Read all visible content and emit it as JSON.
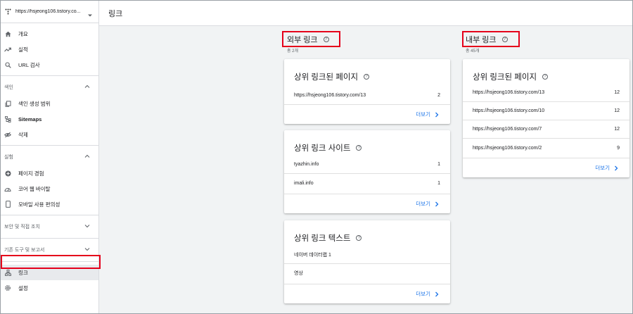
{
  "property": {
    "url": "https://hsjeong106.tistory.co..."
  },
  "sidebar": {
    "items": [
      {
        "label": "개요"
      },
      {
        "label": "실적"
      },
      {
        "label": "URL 검사"
      }
    ],
    "index_section": "색인",
    "index_items": [
      {
        "label": "색인 생성 범위"
      },
      {
        "label": "Sitemaps"
      },
      {
        "label": "삭제"
      }
    ],
    "experience_section": "실험",
    "experience_items": [
      {
        "label": "페이지 경험"
      },
      {
        "label": "코어 웹 바이탈"
      },
      {
        "label": "모바일 사용 편의성"
      }
    ],
    "security_section": "보안 및 직접 조치",
    "legacy_section": "기존 도구 및 보고서",
    "links_label": "링크",
    "settings_label": "설정"
  },
  "header": {
    "title": "링크"
  },
  "external": {
    "title": "외부 링크",
    "total": "총 2개",
    "top_linked_pages": {
      "title": "상위 링크된 페이지",
      "rows": [
        {
          "label": "https://hsjeong106.tistory.com/13",
          "value": "2"
        }
      ],
      "more": "더보기"
    },
    "top_linking_sites": {
      "title": "상위 링크 사이트",
      "rows": [
        {
          "label": "tyazhin.info",
          "value": "1"
        },
        {
          "label": "imali.info",
          "value": "1"
        }
      ],
      "more": "더보기"
    },
    "top_linking_text": {
      "title": "상위 링크 텍스트",
      "rows": [
        {
          "label": "네이버 데이터랩 1"
        },
        {
          "label": "영상"
        }
      ],
      "more": "더보기"
    }
  },
  "internal": {
    "title": "내부 링크",
    "total": "총 45개",
    "top_linked_pages": {
      "title": "상위 링크된 페이지",
      "rows": [
        {
          "label": "https://hsjeong106.tistory.com/13",
          "value": "12"
        },
        {
          "label": "https://hsjeong106.tistory.com/10",
          "value": "12"
        },
        {
          "label": "https://hsjeong106.tistory.com/7",
          "value": "12"
        },
        {
          "label": "https://hsjeong106.tistory.com/2",
          "value": "9"
        }
      ],
      "more": "더보기"
    }
  },
  "colors": {
    "highlight": "#e5001b",
    "link": "#1a73e8"
  },
  "help_glyph": "?"
}
